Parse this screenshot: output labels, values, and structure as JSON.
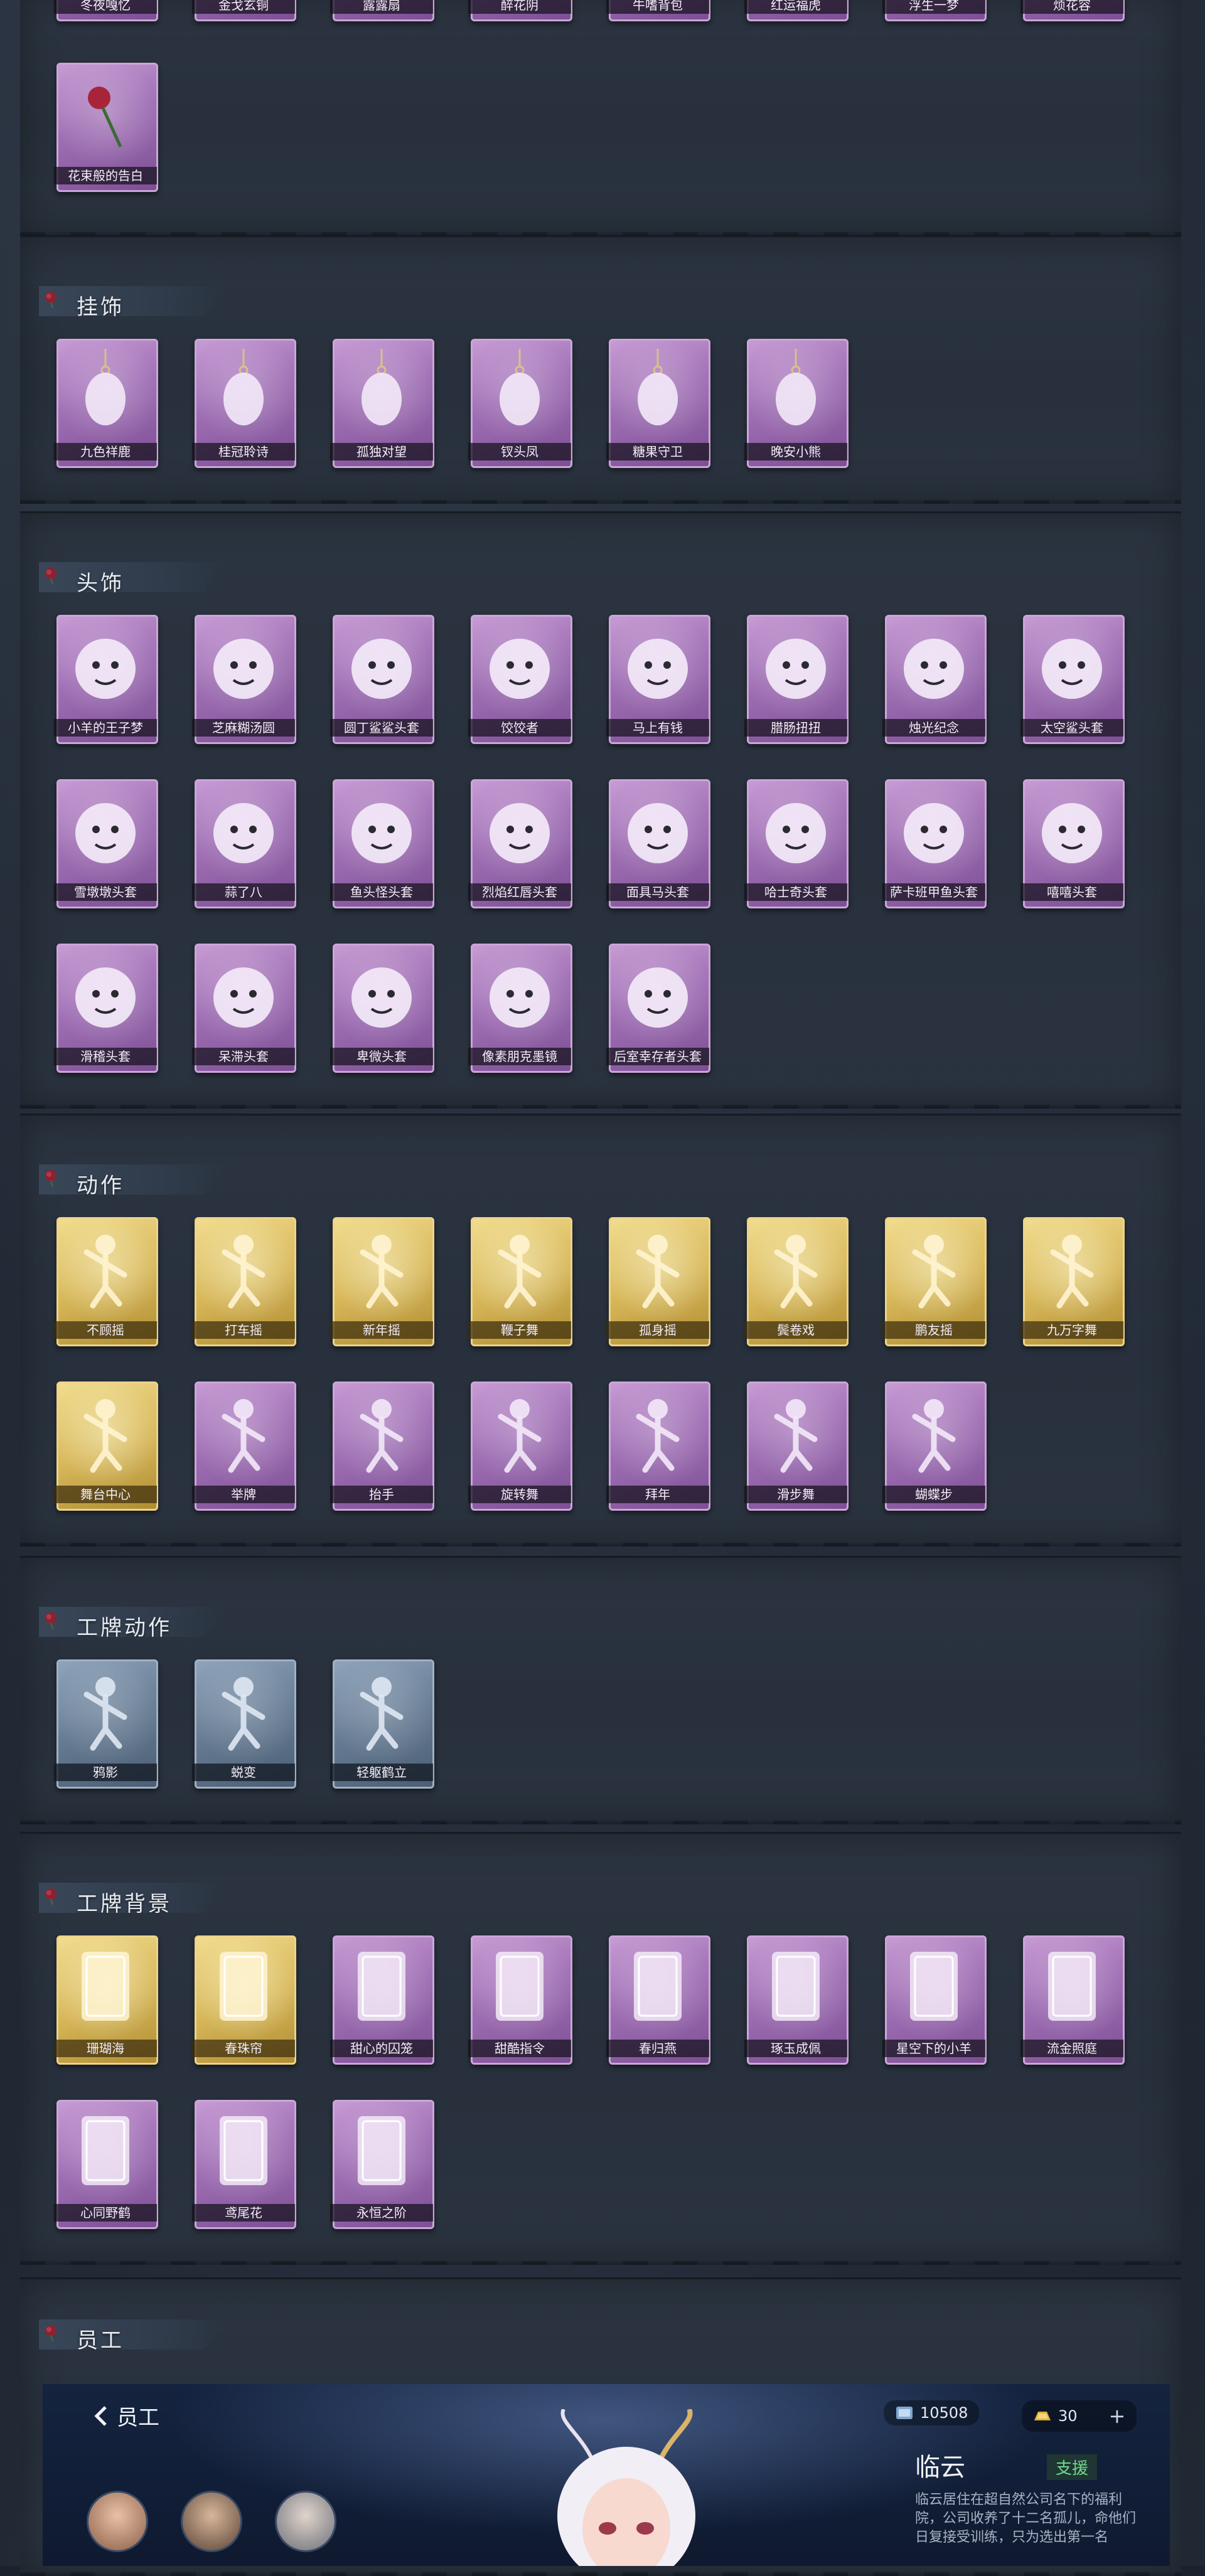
{
  "colors": {
    "purple": "#a173b6",
    "gold": "#d8b85a",
    "blue": "#667b93",
    "section_bg": "#2b3440"
  },
  "top_row": [
    "冬夜嘎忆",
    "金戈玄铜",
    "露露扇",
    "醉花阴",
    "牛嗜背包",
    "红运福虎",
    "浮生一梦",
    "烦花容"
  ],
  "top_extra": [
    {
      "label": "花束般的告白",
      "icon": "rose-icon"
    }
  ],
  "sections": [
    {
      "title": "挂饰",
      "items": [
        {
          "label": "九色祥鹿",
          "icon": "deer-charm-icon"
        },
        {
          "label": "桂冠聆诗",
          "icon": "flower-fairy-charm-icon"
        },
        {
          "label": "孤独对望",
          "icon": "angel-charm-icon"
        },
        {
          "label": "钗头凤",
          "icon": "phoenix-lady-charm-icon"
        },
        {
          "label": "糖果守卫",
          "icon": "lantern-charm-icon"
        },
        {
          "label": "晚安小熊",
          "icon": "bear-charm-icon"
        }
      ]
    },
    {
      "title": "头饰",
      "items": [
        {
          "label": "小羊的王子梦",
          "icon": "sheep-head-icon"
        },
        {
          "label": "芝麻糊汤圆",
          "icon": "dumpling-head-icon"
        },
        {
          "label": "圆丁鲨鲨头套",
          "icon": "shark-head-icon"
        },
        {
          "label": "饺饺者",
          "icon": "cloud-head-icon"
        },
        {
          "label": "马上有钱",
          "icon": "horse-cap-head-icon"
        },
        {
          "label": "腊肠扭扭",
          "icon": "dachshund-head-icon"
        },
        {
          "label": "烛光纪念",
          "icon": "candle-head-icon"
        },
        {
          "label": "太空鲨头套",
          "icon": "space-shark-head-icon"
        },
        {
          "label": "雪墩墩头套",
          "icon": "snow-pig-head-icon"
        },
        {
          "label": "蒜了八",
          "icon": "garlic-head-icon"
        },
        {
          "label": "鱼头怪头套",
          "icon": "fish-head-icon"
        },
        {
          "label": "烈焰红唇头套",
          "icon": "pikachu-head-icon"
        },
        {
          "label": "面具马头套",
          "icon": "horse-mask-head-icon"
        },
        {
          "label": "哈士奇头套",
          "icon": "husky-head-icon"
        },
        {
          "label": "萨卡班甲鱼头套",
          "icon": "sacabambaspis-head-icon"
        },
        {
          "label": "嘻嘻头套",
          "icon": "grin-emoji-head-icon"
        },
        {
          "label": "滑稽头套",
          "icon": "funny-emoji-head-icon"
        },
        {
          "label": "呆滞头套",
          "icon": "dazed-emoji-head-icon"
        },
        {
          "label": "卑微头套",
          "icon": "humble-emoji-head-icon"
        },
        {
          "label": "像素朋克墨镜",
          "icon": "pixel-sunglasses-icon"
        },
        {
          "label": "后室幸存者头套",
          "icon": "gas-mask-icon"
        }
      ]
    },
    {
      "title": "动作",
      "items": [
        {
          "label": "不顾摇",
          "icon": "dance-pose-icon",
          "tier": "gold"
        },
        {
          "label": "打车摇",
          "icon": "dance-pose-icon",
          "tier": "gold"
        },
        {
          "label": "新年摇",
          "icon": "dance-pose-icon",
          "tier": "gold"
        },
        {
          "label": "鞭子舞",
          "icon": "dance-pose-icon",
          "tier": "gold"
        },
        {
          "label": "孤身摇",
          "icon": "dance-pose-icon",
          "tier": "gold"
        },
        {
          "label": "鬓卷戏",
          "icon": "dance-pose-icon",
          "tier": "gold"
        },
        {
          "label": "鹏友摇",
          "icon": "dance-pose-icon",
          "tier": "gold"
        },
        {
          "label": "九万字舞",
          "icon": "dance-pose-icon",
          "tier": "gold"
        },
        {
          "label": "舞台中心",
          "icon": "dance-pose-icon",
          "tier": "gold"
        },
        {
          "label": "举牌",
          "icon": "sign-pose-icon",
          "tier": "purple"
        },
        {
          "label": "抬手",
          "icon": "raise-hand-pose-icon",
          "tier": "purple"
        },
        {
          "label": "旋转舞",
          "icon": "spin-pose-icon",
          "tier": "purple"
        },
        {
          "label": "拜年",
          "icon": "bow-pose-icon",
          "tier": "purple"
        },
        {
          "label": "滑步舞",
          "icon": "slide-pose-icon",
          "tier": "purple"
        },
        {
          "label": "蝴蝶步",
          "icon": "butterfly-pose-icon",
          "tier": "purple"
        }
      ]
    },
    {
      "title": "工牌动作",
      "items": [
        {
          "label": "鸦影",
          "icon": "badge-pose-icon",
          "tier": "blue"
        },
        {
          "label": "蜕变",
          "icon": "badge-pose-icon",
          "tier": "blue"
        },
        {
          "label": "轻躯鹤立",
          "icon": "badge-pose-icon",
          "tier": "blue"
        }
      ]
    },
    {
      "title": "工牌背景",
      "items": [
        {
          "label": "珊瑚海",
          "icon": "card-frame-icon",
          "tier": "gold"
        },
        {
          "label": "春珠帘",
          "icon": "card-frame-icon",
          "tier": "gold"
        },
        {
          "label": "甜心的囚笼",
          "icon": "card-frame-icon",
          "tier": "purple"
        },
        {
          "label": "甜酷指令",
          "icon": "card-frame-icon",
          "tier": "purple"
        },
        {
          "label": "春归燕",
          "icon": "card-frame-icon",
          "tier": "purple"
        },
        {
          "label": "琢玉成佩",
          "icon": "card-frame-icon",
          "tier": "purple"
        },
        {
          "label": "星空下的小羊",
          "icon": "card-frame-icon",
          "tier": "purple"
        },
        {
          "label": "流金照庭",
          "icon": "card-frame-icon",
          "tier": "purple"
        },
        {
          "label": "心同野鹤",
          "icon": "card-frame-icon",
          "tier": "purple"
        },
        {
          "label": "鸢尾花",
          "icon": "card-frame-icon",
          "tier": "purple"
        },
        {
          "label": "永恒之阶",
          "icon": "card-frame-icon",
          "tier": "purple"
        }
      ]
    }
  ],
  "staff": {
    "section_title": "员工",
    "back_label": "员工",
    "currency_a": "10508",
    "currency_b": "30",
    "name": "临云",
    "tag": "支援",
    "description": "临云居住在超自然公司名下的福利院，公司收养了十二名孤儿，命他们日复接受训练，只为选出第一名"
  }
}
